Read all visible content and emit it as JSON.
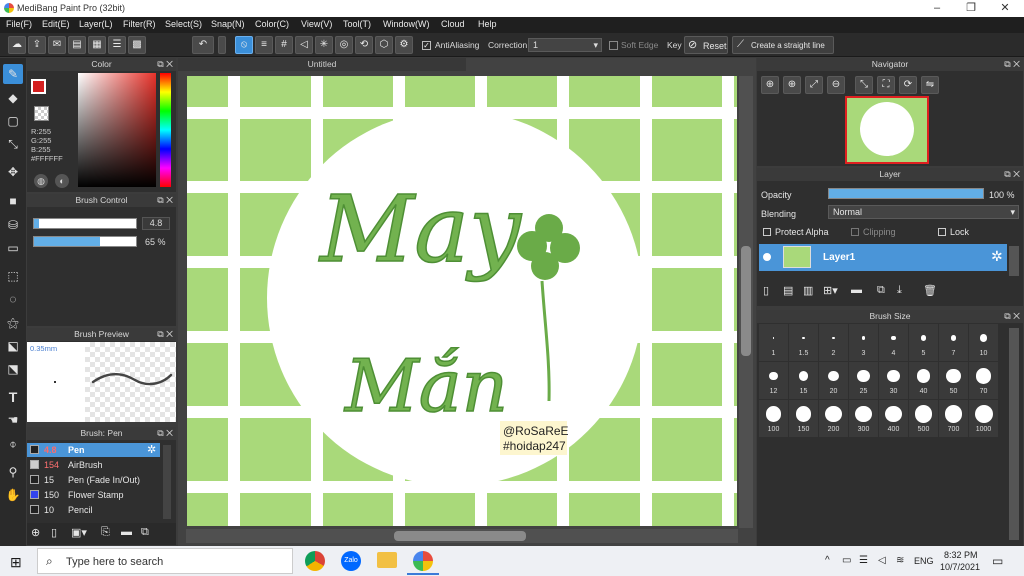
{
  "app": {
    "title": "MediBang Paint Pro (32bit)",
    "document_tab": "Untitled"
  },
  "window_controls": {
    "minimize": "–",
    "maximize": "❐",
    "close": "✕"
  },
  "menu": [
    "File(F)",
    "Edit(E)",
    "Layer(L)",
    "Filter(R)",
    "Select(S)",
    "Snap(N)",
    "Color(C)",
    "View(V)",
    "Tool(T)",
    "Window(W)",
    "Cloud",
    "Help"
  ],
  "toolbar": {
    "antialiasing_label": "AntiAliasing",
    "correction_label": "Correction",
    "correction_value": "1",
    "soft_edge_label": "Soft Edge",
    "key_label": "Key",
    "reset_label": "Reset",
    "straight_line_label": "Create a straight line"
  },
  "color_panel": {
    "title": "Color",
    "r": "R:255",
    "g": "G:255",
    "b": "B:255",
    "hex": "#FFFFFF"
  },
  "brush_control": {
    "title": "Brush Control",
    "size_value": "4.8",
    "opacity_value": "65 %",
    "opacity_fraction": 0.65,
    "size_fraction": 0.05
  },
  "brush_preview": {
    "title": "Brush Preview",
    "size_text": "0.35mm"
  },
  "brush_list": {
    "title": "Brush: Pen",
    "items": [
      {
        "size": "4.8",
        "name": "Pen",
        "color": "#222222",
        "selected": true
      },
      {
        "size": "154",
        "name": "AirBrush",
        "color": "#cccccc",
        "selected": false
      },
      {
        "size": "15",
        "name": "Pen (Fade In/Out)",
        "color": "#222222",
        "selected": false
      },
      {
        "size": "150",
        "name": "Flower Stamp",
        "color": "#3344ee",
        "selected": false
      },
      {
        "size": "10",
        "name": "Pencil",
        "color": "#222222",
        "selected": false
      }
    ]
  },
  "artwork": {
    "title_line1": "May",
    "title_line2": "Mắn",
    "credit1": "@RoSaReE",
    "credit2": "#hoidap247",
    "bg_color": "#a9d97a",
    "grid_color": "#ffffff",
    "ink_color": "#6aab48"
  },
  "navigator": {
    "title": "Navigator"
  },
  "layer_panel": {
    "title": "Layer",
    "opacity_label": "Opacity",
    "opacity_value": "100 %",
    "opacity_fraction": 1.0,
    "blending_label": "Blending",
    "blending_value": "Normal",
    "protect_alpha": "Protect Alpha",
    "clipping": "Clipping",
    "lock": "Lock",
    "layer_name": "Layer1"
  },
  "brush_size": {
    "title": "Brush Size",
    "sizes": [
      "1",
      "1.5",
      "2",
      "3",
      "4",
      "5",
      "7",
      "10",
      "12",
      "15",
      "20",
      "25",
      "30",
      "40",
      "50",
      "70",
      "100",
      "150",
      "200",
      "300",
      "400",
      "500",
      "700",
      "1000"
    ]
  },
  "taskbar": {
    "search_placeholder": "Type here to search",
    "time": "8:32 PM",
    "date": "10/7/2021",
    "lang": "ENG"
  }
}
